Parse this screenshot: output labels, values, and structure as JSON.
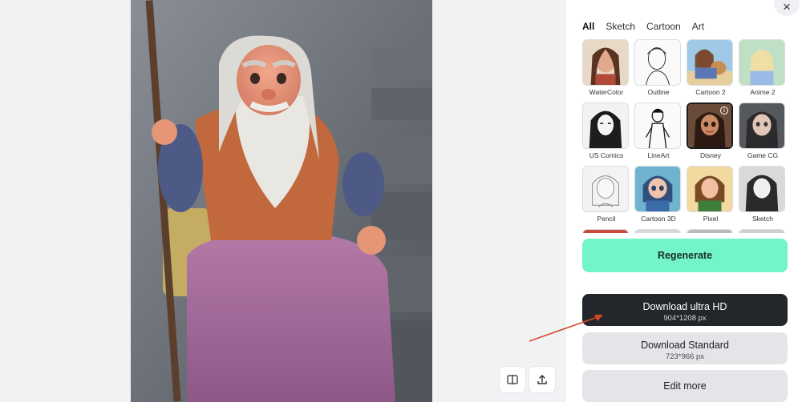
{
  "tabs": [
    {
      "label": "All",
      "active": true
    },
    {
      "label": "Sketch"
    },
    {
      "label": "Cartoon"
    },
    {
      "label": "Art"
    }
  ],
  "styles": [
    {
      "label": "WaterColor"
    },
    {
      "label": "Outline"
    },
    {
      "label": "Cartoon 2"
    },
    {
      "label": "Anime 2"
    },
    {
      "label": "US Comics"
    },
    {
      "label": "LineArt"
    },
    {
      "label": "Disney",
      "selected": true
    },
    {
      "label": "Game CG"
    },
    {
      "label": "Pencil"
    },
    {
      "label": "Cartoon 3D"
    },
    {
      "label": "Pixel"
    },
    {
      "label": "Sketch"
    }
  ],
  "actions": {
    "regenerate_label": "Regenerate",
    "download_hd_label": "Download ultra HD",
    "download_hd_size": "904*1208 px",
    "download_std_label": "Download Standard",
    "download_std_size": "723*966 px",
    "edit_more_label": "Edit more",
    "close_symbol": "×"
  },
  "icons": {
    "compare": "compare-icon",
    "share": "upload-icon",
    "info": "info-icon",
    "close": "close-icon"
  },
  "colors": {
    "accent": "#74f4c9",
    "dark_button": "#23262b",
    "annotation_arrow": "#d9472b"
  }
}
